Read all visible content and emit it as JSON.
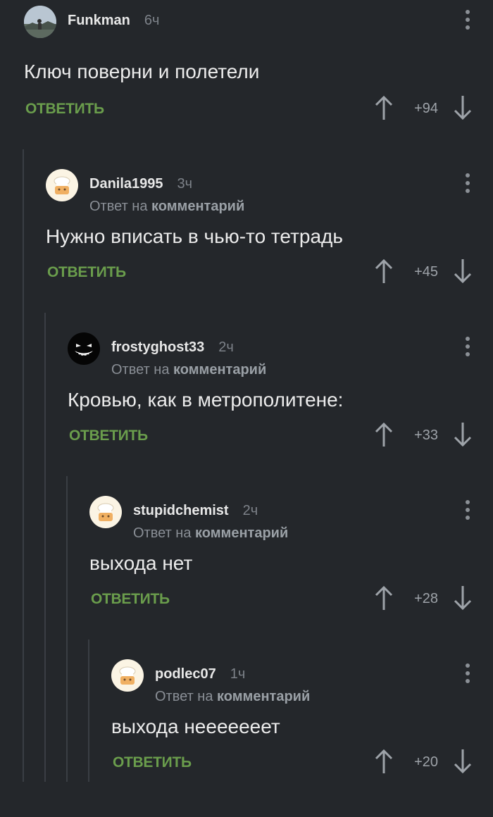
{
  "reply_label": "ОТВЕТИТЬ",
  "reply_to_prefix": "Ответ на",
  "reply_to_target": "комментарий",
  "colors": {
    "background": "#24272b",
    "reply_button": "#6a9d4c",
    "thread_line": "#3a3e44"
  },
  "comments": [
    {
      "username": "Funkman",
      "time": "6ч",
      "text": "Ключ поверни и полетели",
      "rating": "+94",
      "avatar": "photo-avatar"
    },
    {
      "username": "Danila1995",
      "time": "3ч",
      "text": "Нужно вписать в чью-то тетрадь",
      "rating": "+45",
      "avatar": "cook-avatar"
    },
    {
      "username": "frostyghost33",
      "time": "2ч",
      "text": "Кровью, как в метрополитене:",
      "rating": "+33",
      "avatar": "ghost-face-avatar"
    },
    {
      "username": "stupidchemist",
      "time": "2ч",
      "text": "выхода нет",
      "rating": "+28",
      "avatar": "cook-avatar"
    },
    {
      "username": "podlec07",
      "time": "1ч",
      "text": "выхода нееееееет",
      "rating": "+20",
      "avatar": "cook-avatar"
    }
  ]
}
